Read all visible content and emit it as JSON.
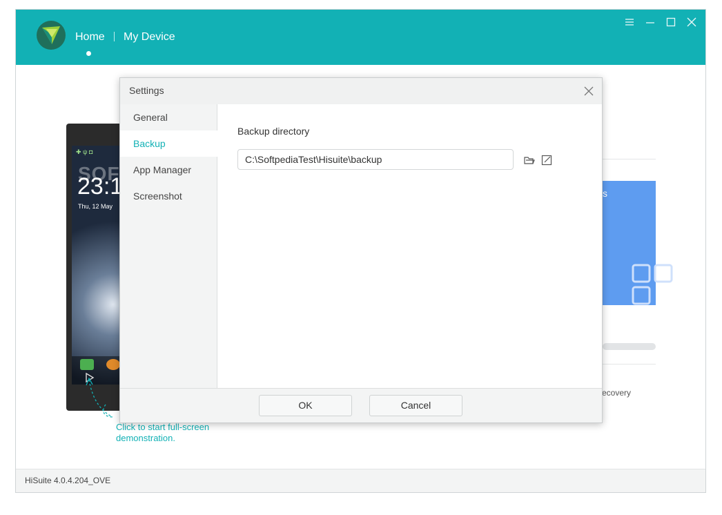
{
  "titlebar": {
    "nav": {
      "home": "Home",
      "my_device": "My Device"
    },
    "icons": [
      "menu-icon",
      "minimize-icon",
      "maximize-icon",
      "close-icon"
    ],
    "accent_color": "#12b1b5"
  },
  "background": {
    "phone": {
      "clock": "23:1",
      "date": "Thu, 12 May"
    },
    "watermark": "SOFTPEDIA",
    "hint": {
      "line1": "Click to start full-screen",
      "line2": "demonstration."
    },
    "recovery_text": "ecovery",
    "tile_text": "s"
  },
  "dialog": {
    "title": "Settings",
    "sidebar": {
      "items": [
        {
          "label": "General"
        },
        {
          "label": "Backup"
        },
        {
          "label": "App Manager"
        },
        {
          "label": "Screenshot"
        }
      ],
      "active": "Backup"
    },
    "backup": {
      "label": "Backup directory",
      "path": "C:\\SoftpediaTest\\Hisuite\\backup"
    },
    "buttons": {
      "ok": "OK",
      "cancel": "Cancel"
    }
  },
  "footer": {
    "version": "HiSuite 4.0.4.204_OVE"
  }
}
